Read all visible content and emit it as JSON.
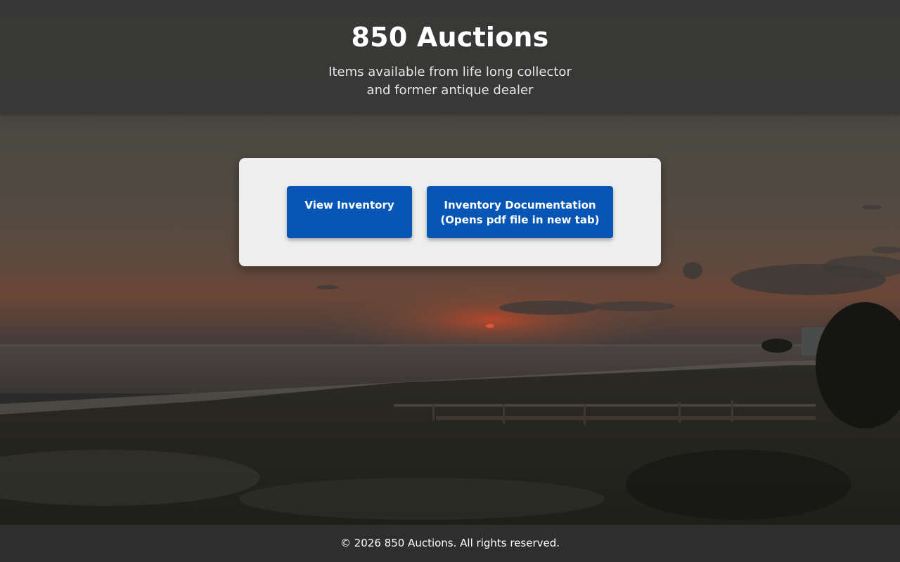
{
  "header": {
    "title": "850 Auctions",
    "tagline_line1": "Items available from life long collector",
    "tagline_line2": "and former antique dealer"
  },
  "actions": {
    "view_inventory_label": "View Inventory",
    "docs_label_line1": "Inventory Documentation",
    "docs_label_line2": "(Opens pdf file in new tab)"
  },
  "footer": {
    "copyright": "© 2026 850 Auctions. All rights reserved."
  },
  "colors": {
    "header_bg": "#373737",
    "card_bg": "#efeeee",
    "button_bg": "#0756b6",
    "footer_bg": "#2e2e2e"
  },
  "background": {
    "scene": "sunset-beach-photo"
  }
}
